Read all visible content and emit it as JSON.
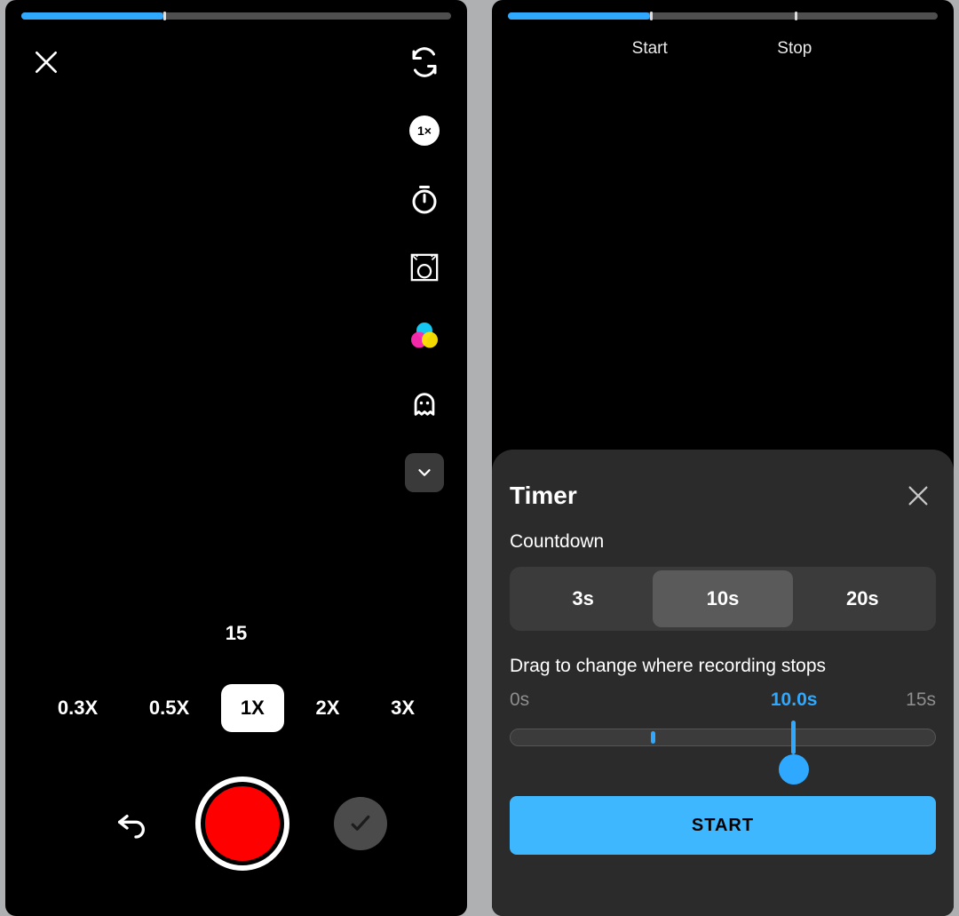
{
  "colors": {
    "accent": "#2ea9ff",
    "record": "#ff0000"
  },
  "left": {
    "progress_percent": 33,
    "speed_badge": "1×",
    "clip_count": "15",
    "speeds": [
      "0.3X",
      "0.5X",
      "1X",
      "2X",
      "3X"
    ],
    "speed_active_index": 2,
    "side_icons": [
      "flip",
      "speed",
      "timer",
      "beautify",
      "filters",
      "effects",
      "more"
    ]
  },
  "right": {
    "progress_percent": 33,
    "start_label": "Start",
    "stop_label": "Stop",
    "start_marker_percent": 33,
    "stop_marker_percent": 66.7,
    "sheet": {
      "title": "Timer",
      "subtitle": "Countdown",
      "options": [
        "3s",
        "10s",
        "20s"
      ],
      "option_active_index": 1,
      "drag_label": "Drag to change where recording stops",
      "slider_min_label": "0s",
      "slider_max_label": "15s",
      "slider_value_label": "10.0s",
      "slider_start_percent": 33,
      "slider_value_percent": 66.7,
      "start_button": "START"
    }
  }
}
